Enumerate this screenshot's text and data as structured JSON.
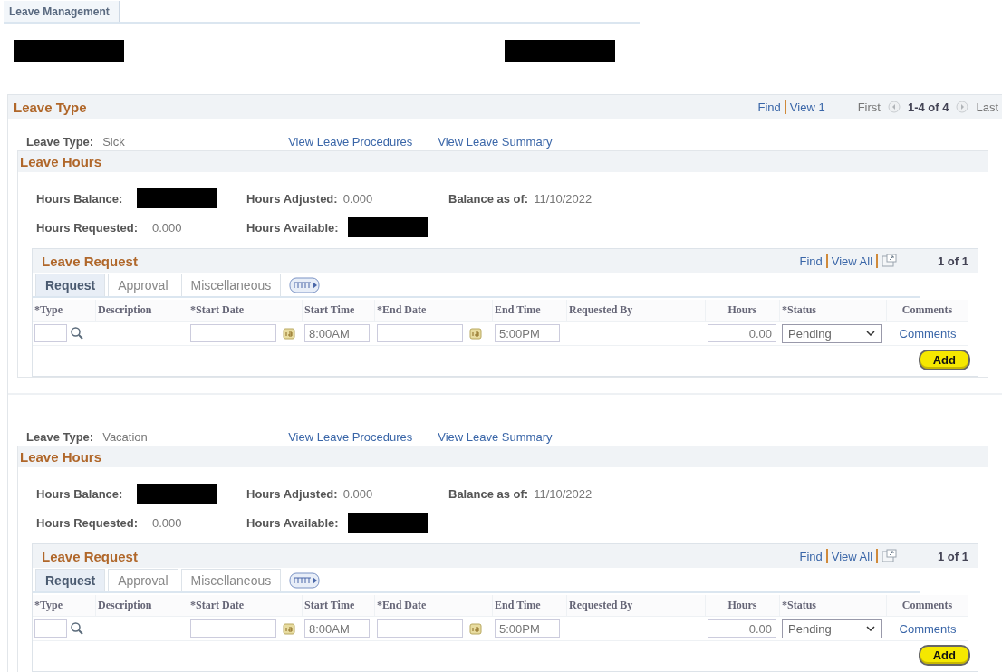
{
  "tab": {
    "label": "Leave Management",
    "selected": true
  },
  "header_redactions": [
    {
      "redacted": true
    },
    {
      "redacted": true
    }
  ],
  "leave_type_section": {
    "title": "Leave Type",
    "nav": {
      "find": "Find",
      "view": "View 1",
      "first": "First",
      "range": "1-4 of 4",
      "last": "Last"
    },
    "leave_types": [
      {
        "label": "Leave Type:",
        "value": "Sick",
        "links": [
          "View Leave Procedures",
          "View Leave Summary"
        ],
        "hours": {
          "title": "Leave Hours",
          "fields": [
            {
              "label": "Hours Balance:",
              "redacted": true
            },
            {
              "label": "Hours Adjusted:",
              "value": "0.000"
            },
            {
              "label": "Balance as of:",
              "value": "11/10/2022"
            },
            {
              "label": "Hours Requested:",
              "value": "0.000"
            },
            {
              "label": "Hours Available:",
              "redacted": true
            }
          ]
        },
        "request": {
          "title": "Leave Request",
          "nav": {
            "find": "Find",
            "view_all": "View All",
            "count": "1 of 1"
          },
          "tabs": [
            {
              "label": "Request",
              "selected": true
            },
            {
              "label": "Approval",
              "selected": false
            },
            {
              "label": "Miscellaneous",
              "selected": false
            }
          ],
          "columns": [
            "*Type",
            "Description",
            "*Start Date",
            "Start Time",
            "*End Date",
            "End Time",
            "Requested By",
            "Hours",
            "*Status",
            "Comments"
          ],
          "row": {
            "start_time": "8:00AM",
            "end_time": "5:00PM",
            "hours": "0.00",
            "status": "Pending",
            "comments": "Comments"
          },
          "add": "Add"
        }
      },
      {
        "label": "Leave Type:",
        "value": "Vacation",
        "links": [
          "View Leave Procedures",
          "View Leave Summary"
        ],
        "hours": {
          "title": "Leave Hours",
          "fields": [
            {
              "label": "Hours Balance:",
              "redacted": true
            },
            {
              "label": "Hours Adjusted:",
              "value": "0.000"
            },
            {
              "label": "Balance as of:",
              "value": "11/10/2022"
            },
            {
              "label": "Hours Requested:",
              "value": "0.000"
            },
            {
              "label": "Hours Available:",
              "redacted": true
            }
          ]
        },
        "request": {
          "title": "Leave Request",
          "nav": {
            "find": "Find",
            "view_all": "View All",
            "count": "1 of 1"
          },
          "tabs": [
            {
              "label": "Request",
              "selected": true
            },
            {
              "label": "Approval",
              "selected": false
            },
            {
              "label": "Miscellaneous",
              "selected": false
            }
          ],
          "columns": [
            "*Type",
            "Description",
            "*Start Date",
            "Start Time",
            "*End Date",
            "End Time",
            "Requested By",
            "Hours",
            "*Status",
            "Comments"
          ],
          "row": {
            "start_time": "8:00AM",
            "end_time": "5:00PM",
            "hours": "0.00",
            "status": "Pending",
            "comments": "Comments"
          },
          "add": "Add"
        }
      }
    ]
  }
}
